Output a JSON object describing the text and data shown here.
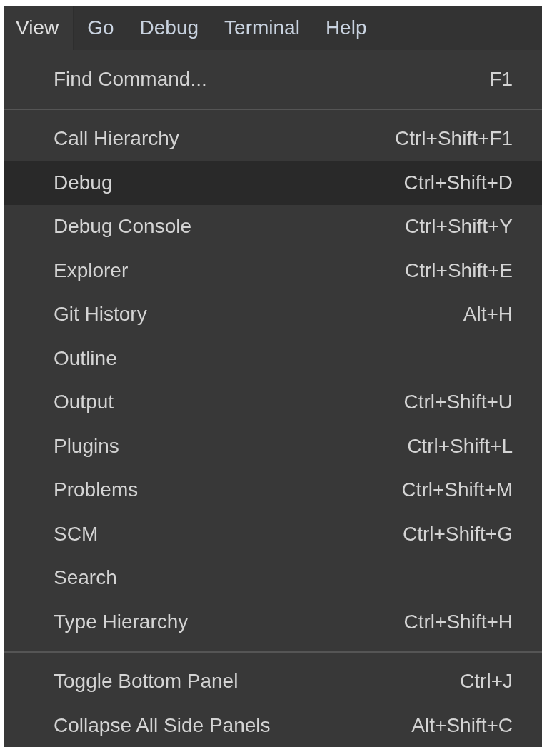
{
  "menubar": {
    "items": [
      {
        "label": "View",
        "selected": true
      },
      {
        "label": "Go",
        "selected": false
      },
      {
        "label": "Debug",
        "selected": false
      },
      {
        "label": "Terminal",
        "selected": false
      },
      {
        "label": "Help",
        "selected": false
      }
    ]
  },
  "menu": {
    "sections": [
      [
        {
          "label": "Find Command...",
          "shortcut": "F1",
          "selected": false
        }
      ],
      [
        {
          "label": "Call Hierarchy",
          "shortcut": "Ctrl+Shift+F1",
          "selected": false
        },
        {
          "label": "Debug",
          "shortcut": "Ctrl+Shift+D",
          "selected": true
        },
        {
          "label": "Debug Console",
          "shortcut": "Ctrl+Shift+Y",
          "selected": false
        },
        {
          "label": "Explorer",
          "shortcut": "Ctrl+Shift+E",
          "selected": false
        },
        {
          "label": "Git History",
          "shortcut": "Alt+H",
          "selected": false
        },
        {
          "label": "Outline",
          "selected": false
        },
        {
          "label": "Output",
          "shortcut": "Ctrl+Shift+U",
          "selected": false
        },
        {
          "label": "Plugins",
          "shortcut": "Ctrl+Shift+L",
          "selected": false
        },
        {
          "label": "Problems",
          "shortcut": "Ctrl+Shift+M",
          "selected": false
        },
        {
          "label": "SCM",
          "shortcut": "Ctrl+Shift+G",
          "selected": false
        },
        {
          "label": "Search",
          "selected": false
        },
        {
          "label": "Type Hierarchy",
          "shortcut": "Ctrl+Shift+H",
          "selected": false
        }
      ],
      [
        {
          "label": "Toggle Bottom Panel",
          "shortcut": "Ctrl+J",
          "selected": false
        },
        {
          "label": "Collapse All Side Panels",
          "shortcut": "Alt+Shift+C",
          "selected": false
        }
      ]
    ]
  }
}
